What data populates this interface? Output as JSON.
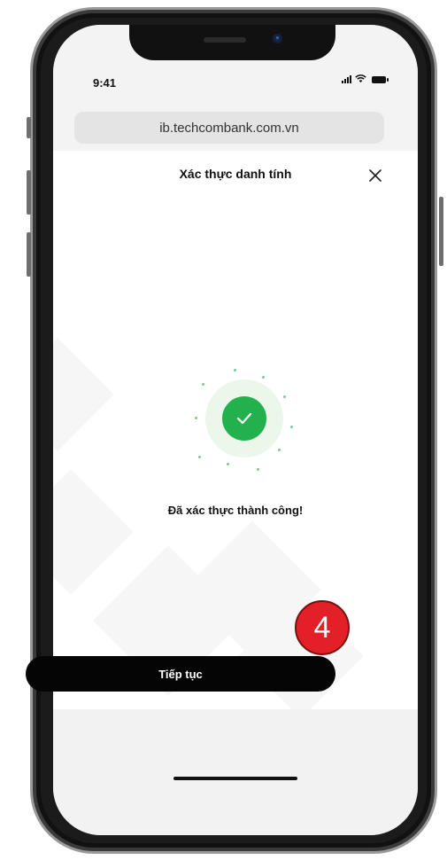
{
  "status_bar": {
    "time": "9:41"
  },
  "browser": {
    "url": "ib.techcombank.com.vn"
  },
  "header": {
    "title": "Xác thực danh tính"
  },
  "icons": {
    "close": "close-icon",
    "success": "check-icon"
  },
  "success": {
    "message": "Đã xác thực thành công!"
  },
  "actions": {
    "continue_label": "Tiếp tục"
  },
  "annotation": {
    "step_number": "4"
  },
  "colors": {
    "success_green": "#22b14c",
    "button_black": "#050505",
    "step_badge_red": "#e32027"
  }
}
